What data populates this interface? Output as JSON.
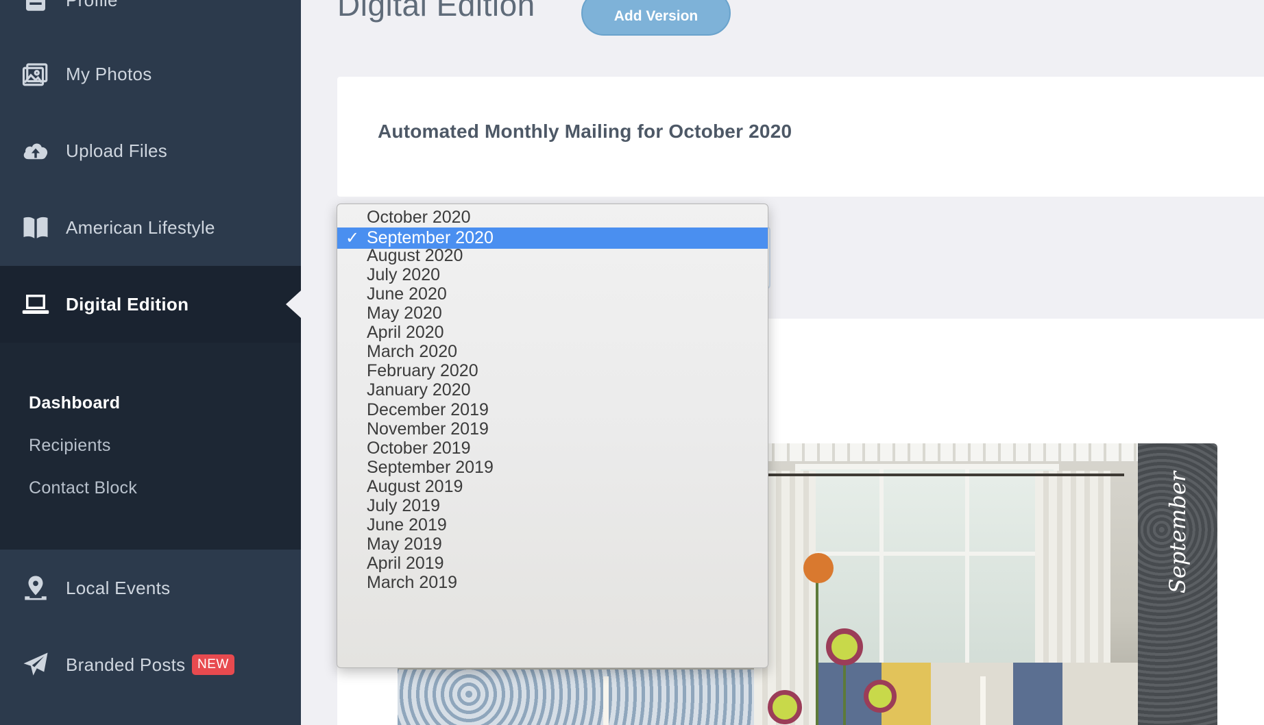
{
  "sidebar": {
    "items": [
      {
        "label": "Profile",
        "icon": "profile-icon"
      },
      {
        "label": "My Photos",
        "icon": "photos-icon"
      },
      {
        "label": "Upload Files",
        "icon": "cloud-upload-icon"
      },
      {
        "label": "American Lifestyle",
        "icon": "book-icon"
      },
      {
        "label": "Digital Edition",
        "icon": "laptop-icon",
        "active": true
      },
      {
        "label": "Local Events",
        "icon": "map-pin-icon"
      },
      {
        "label": "Branded Posts",
        "icon": "paper-plane-icon",
        "badge": "NEW"
      }
    ],
    "subnav": [
      {
        "label": "Dashboard",
        "current": true
      },
      {
        "label": "Recipients"
      },
      {
        "label": "Contact Block"
      }
    ]
  },
  "main": {
    "page_title": "Digital Edition",
    "add_version_label": "Add Version",
    "mailing_title": "Automated Monthly Mailing for October 2020",
    "magazine_spine_text": "September"
  },
  "month_select": {
    "selected": "September 2020",
    "options": [
      "October 2020",
      "September 2020",
      "August 2020",
      "July 2020",
      "June 2020",
      "May 2020",
      "April 2020",
      "March 2020",
      "February 2020",
      "January 2020",
      "December 2019",
      "November 2019",
      "October 2019",
      "September 2019",
      "August 2019",
      "July 2019",
      "June 2019",
      "May 2019",
      "April 2019",
      "March 2019"
    ],
    "check_glyph": "✓"
  },
  "colors": {
    "sidebar_bg": "#2c3a4c",
    "sidebar_active_bg": "#1a2330",
    "accent_button": "#7eb2d8",
    "selection_blue": "#4a8ff0",
    "badge_red": "#e84a4f"
  }
}
